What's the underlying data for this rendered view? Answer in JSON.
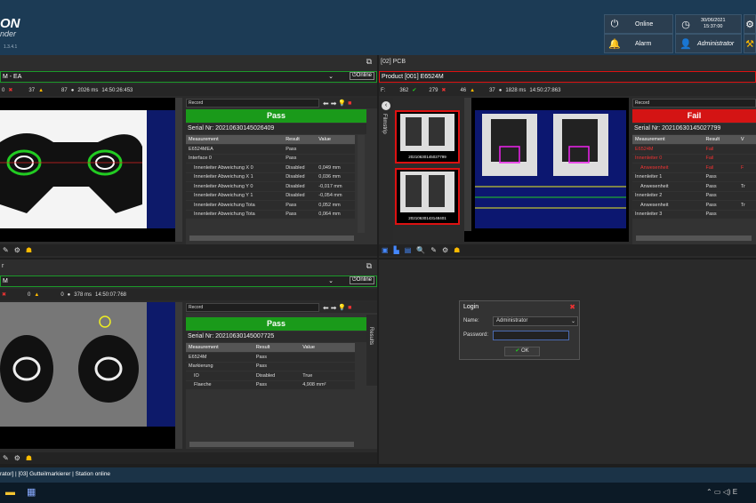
{
  "header": {
    "logo_main": "ON",
    "logo_sub": "nder",
    "version": "1.3.4.1",
    "online_label": "Online",
    "alarm_label": "Alarm",
    "date": "30/06/2021",
    "time": "15:37:00",
    "user_label": "Administrator"
  },
  "panel_tl": {
    "title": "",
    "product": "M - EA",
    "online_btn": "Online",
    "stats": {
      "fail": "0",
      "warn": "37",
      "info": "87",
      "ms": "2026 ms",
      "ts": "14:50:26:453"
    },
    "record": "Record",
    "verdict": "Pass",
    "serial": "Serial Nr: 20210630145026409",
    "headers": [
      "Measurement",
      "Result",
      "Value"
    ],
    "rows": [
      [
        "E6524MEA",
        "Pass",
        ""
      ],
      [
        "Interface 0",
        "Pass",
        ""
      ],
      [
        "Innenleiter Abweichung X 0",
        "Disabled",
        "0,049 mm"
      ],
      [
        "Innenleiter Abweichung X 1",
        "Disabled",
        "0,036 mm"
      ],
      [
        "Innenleiter Abweichung Y 0",
        "Disabled",
        "-0,017 mm"
      ],
      [
        "Innenleiter Abweichung Y 1",
        "Disabled",
        "-0,054 mm"
      ],
      [
        "Innenleiter Abweichung Tota",
        "Pass",
        "0,052 mm"
      ],
      [
        "Innenleiter Abweichung Tota",
        "Pass",
        "0,064 mm"
      ]
    ]
  },
  "panel_tr": {
    "title": "[02] PCB",
    "product": "Product [001]  E6524M",
    "stats": {
      "f": "F:",
      "pass": "362",
      "fail": "279",
      "warn": "46",
      "info": "37",
      "ms": "1828 ms",
      "ts": "14:50:27:863"
    },
    "filmstrip_label": "Filmstrip",
    "thumbs": [
      "20210630145027799",
      "20210630143148401"
    ],
    "record": "Record",
    "verdict": "Fail",
    "serial": "Serial Nr: 20210630145027799",
    "headers": [
      "Measurement",
      "Result",
      "V"
    ],
    "rows": [
      [
        "E6524M",
        "Fail",
        ""
      ],
      [
        "Innenleiter 0",
        "Fail",
        ""
      ],
      [
        "Anwesenheit",
        "Fail",
        "F"
      ],
      [
        "Innenleiter 1",
        "Pass",
        ""
      ],
      [
        "Anwesenheit",
        "Pass",
        "Tr"
      ],
      [
        "Innenleiter 2",
        "Pass",
        ""
      ],
      [
        "Anwesenheit",
        "Pass",
        "Tr"
      ],
      [
        "Innenleiter 3",
        "Pass",
        ""
      ]
    ]
  },
  "panel_bl": {
    "title": "r",
    "product": "M",
    "online_btn": "Online",
    "stats": {
      "fail": "0",
      "warn": "0",
      "info": "0",
      "ms": "378 ms",
      "ts": "14:50:07:768"
    },
    "record": "Record",
    "verdict": "Pass",
    "serial": "Serial Nr: 20210630145007725",
    "results_label": "Results",
    "headers": [
      "Measurement",
      "Result",
      "Value"
    ],
    "rows": [
      [
        "E6524M",
        "Pass",
        ""
      ],
      [
        "Markierung",
        "Pass",
        ""
      ],
      [
        "IO",
        "Disabled",
        "True"
      ],
      [
        "Flaeche",
        "Pass",
        "4,908 mm²"
      ]
    ]
  },
  "login": {
    "title": "Login",
    "name_label": "Name:",
    "name_value": "Administrator",
    "password_label": "Password:",
    "ok_label": "OK"
  },
  "statusbar": {
    "text": "rator] | [03] Gutteilmarkierer | Station online"
  },
  "colors": {
    "pass": "#1a9a1a",
    "fail": "#d41414",
    "header": "#1c3b55"
  }
}
